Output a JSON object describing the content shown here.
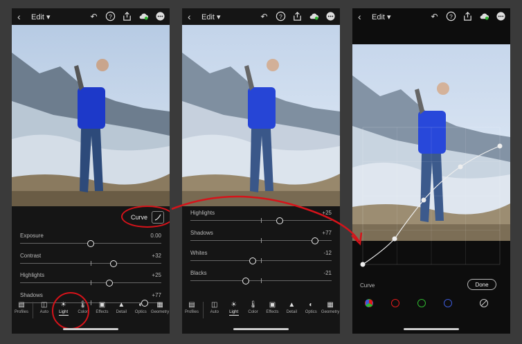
{
  "panel1": {
    "edit_label": "Edit",
    "curve_label": "Curve",
    "sliders": [
      {
        "label": "Exposure",
        "value": "0.00",
        "pos": 0.5
      },
      {
        "label": "Contrast",
        "value": "+32",
        "pos": 0.66
      },
      {
        "label": "Highlights",
        "value": "+25",
        "pos": 0.63
      },
      {
        "label": "Shadows",
        "value": "+77",
        "pos": 0.88
      }
    ]
  },
  "panel2": {
    "edit_label": "Edit",
    "sliders": [
      {
        "label": "Highlights",
        "value": "+25",
        "pos": 0.63
      },
      {
        "label": "Shadows",
        "value": "+77",
        "pos": 0.88
      },
      {
        "label": "Whites",
        "value": "-12",
        "pos": 0.44
      },
      {
        "label": "Blacks",
        "value": "-21",
        "pos": 0.39
      }
    ]
  },
  "panel3": {
    "edit_label": "Edit",
    "curve_label": "Curve",
    "done_label": "Done"
  },
  "tools": [
    "Profiles",
    "Auto",
    "Light",
    "Color",
    "Effects",
    "Detail",
    "Optics",
    "Geometry"
  ],
  "colors": {
    "annotation_red": "#d6131a",
    "channel_red": "#e11b1b",
    "channel_green": "#2fb82f",
    "channel_blue": "#3d5bd9"
  },
  "icons": [
    "back-icon",
    "undo-icon",
    "help-icon",
    "share-icon",
    "cloud-icon",
    "more-icon"
  ]
}
